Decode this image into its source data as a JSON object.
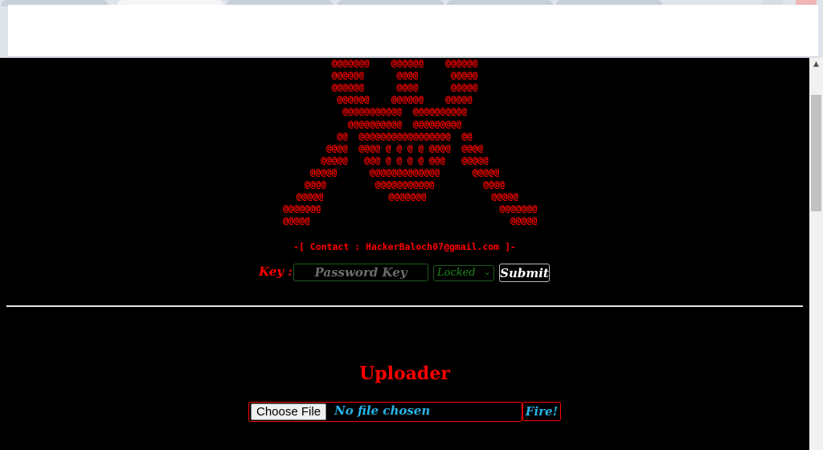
{
  "page": {
    "ascii_art": "  @@  @@@@@@@@@@@@@@@@@@@@@@@@@  @@\n @@@@@@@    @@@@@@    @@@@@@ \n @@@@@@      @@@@      @@@@@ \n @@@@@@      @@@@      @@@@@ \n  @@@@@@    @@@@@@    @@@@@  \n   @@@@@@@@@@@  @@@@@@@@@@   \n    @@@@@@@@@@  @@@@@@@@@    \n  @@  @@@@@@@@@@@@@@@@@  @@  \n  @@@@  @@@@ @ @ @ @ @@@@  @@@@  \n  @@@@@   @@@ @ @ @ @ @@@   @@@@@  \n   @@@@@      @@@@@@@@@@@@@      @@@@@   \n  @@@@         @@@@@@@@@@@         @@@@  \n  @@@@@            @@@@@@@            @@@@@ \n  @@@@@@@                                 @@@@@@@\n  @@@@@                                     @@@@@",
    "contact": "-[ Contact : HackerBaloch07@gmail.com ]-",
    "key_label": "Key :",
    "key_placeholder": "Password Key",
    "lock_value": "Locked",
    "submit_label": "Submit",
    "uploader_title": "Uploader",
    "choose_file_label": "Choose File",
    "no_file_text": "No file chosen",
    "fire_label": "Fire!"
  },
  "colors": {
    "background": "#000000",
    "accent_red": "#ff0000",
    "accent_green": "#1e8a1e",
    "accent_cyan": "#27b4e8"
  }
}
